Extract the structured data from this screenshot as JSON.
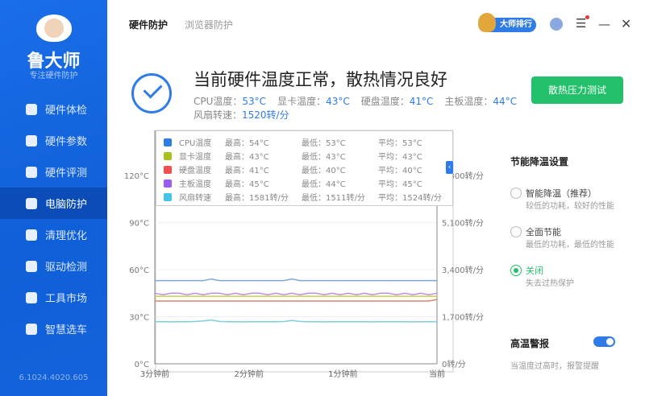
{
  "sidebar": {
    "logo_title": "鲁大师",
    "logo_subtitle": "专注硬件防护",
    "version": "6.1024.4020.605",
    "items": [
      {
        "label": "硬件体检",
        "icon": "monitor-icon"
      },
      {
        "label": "硬件参数",
        "icon": "list-icon"
      },
      {
        "label": "硬件评测",
        "icon": "gauge-icon"
      },
      {
        "label": "电脑防护",
        "icon": "shield-icon"
      },
      {
        "label": "清理优化",
        "icon": "broom-icon"
      },
      {
        "label": "驱动检测",
        "icon": "gear-icon"
      },
      {
        "label": "工具市场",
        "icon": "toolbox-icon"
      },
      {
        "label": "智慧选车",
        "icon": "car-icon"
      }
    ],
    "active": 3
  },
  "header": {
    "tabs": [
      "硬件防护",
      "浏览器防护"
    ],
    "rank_label": "大师排行"
  },
  "status": {
    "headline": "当前硬件温度正常，散热情况良好",
    "stats": [
      {
        "label": "CPU温度：",
        "value": "53°C"
      },
      {
        "label": "显卡温度：",
        "value": "43°C"
      },
      {
        "label": "硬盘温度：",
        "value": "41°C"
      },
      {
        "label": "主板温度：",
        "value": "44°C"
      },
      {
        "label": "风扇转速：",
        "value": "1520转/分"
      }
    ],
    "stress_button": "散热压力测试"
  },
  "legend": [
    {
      "name": "CPU温度",
      "max": "最高：54°C",
      "min": "最低：53°C",
      "avg": "平均：53°C",
      "color": "#2f7be8"
    },
    {
      "name": "显卡温度",
      "max": "最高：43°C",
      "min": "最低：43°C",
      "avg": "平均：43°C",
      "color": "#a8c41a"
    },
    {
      "name": "硬盘温度",
      "max": "最高：41°C",
      "min": "最低：40°C",
      "avg": "平均：40°C",
      "color": "#f05050"
    },
    {
      "name": "主板温度",
      "max": "最高：45°C",
      "min": "最低：44°C",
      "avg": "平均：45°C",
      "color": "#9a5cf0"
    },
    {
      "name": "风扇转速",
      "max": "最高：1581转/分",
      "min": "最低：1511转/分",
      "avg": "平均：1524转/分",
      "color": "#40c4e8"
    }
  ],
  "chart_data": {
    "type": "line",
    "x_labels": [
      "3分钟前",
      "2分钟前",
      "1分钟前",
      "当前"
    ],
    "y_left": {
      "ticks": [
        "0°C",
        "30°C",
        "60°C",
        "90°C",
        "120°C"
      ],
      "range": [
        0,
        120
      ]
    },
    "y_right": {
      "ticks": [
        "0转/分",
        "1,700转/分",
        "3,400转/分",
        "5,100转/分",
        "6,800转/分"
      ],
      "range": [
        0,
        6800
      ]
    },
    "series": [
      {
        "name": "CPU温度",
        "axis": "left",
        "color": "#7fa8d8",
        "values": [
          53,
          53,
          53,
          53,
          53,
          53,
          53,
          54,
          53,
          53,
          53,
          53,
          53,
          53,
          53,
          53,
          53,
          54,
          53,
          53,
          53,
          53,
          53,
          53,
          53,
          53,
          53,
          53,
          53,
          53,
          53,
          53,
          53,
          53,
          53,
          53
        ]
      },
      {
        "name": "主板温度",
        "axis": "left",
        "color": "#c08ce8",
        "values": [
          45,
          44,
          45,
          45,
          44,
          45,
          44,
          45,
          45,
          44,
          45,
          44,
          45,
          45,
          44,
          45,
          44,
          45,
          44,
          45,
          45,
          44,
          45,
          44,
          45,
          44,
          45,
          44,
          45,
          45,
          44,
          45,
          44,
          45,
          44,
          45
        ]
      },
      {
        "name": "显卡温度",
        "axis": "left",
        "color": "#c8d040",
        "values": [
          43,
          43,
          43,
          43,
          43,
          43,
          43,
          43,
          43,
          43,
          43,
          43,
          43,
          43,
          43,
          43,
          43,
          43,
          43,
          43,
          43,
          43,
          43,
          43,
          43,
          43,
          43,
          43,
          43,
          43,
          43,
          43,
          43,
          43,
          43,
          43
        ]
      },
      {
        "name": "硬盘温度",
        "axis": "left",
        "color": "#e08070",
        "values": [
          40,
          40,
          40,
          40,
          40,
          40,
          40,
          40,
          40,
          40,
          40,
          40,
          40,
          40,
          40,
          40,
          40,
          40,
          40,
          40,
          40,
          40,
          40,
          40,
          40,
          40,
          40,
          40,
          40,
          40,
          40,
          40,
          40,
          40,
          40,
          41
        ]
      },
      {
        "name": "风扇转速",
        "axis": "right",
        "color": "#80cce0",
        "values": [
          1520,
          1520,
          1515,
          1520,
          1520,
          1525,
          1545,
          1581,
          1530,
          1520,
          1520,
          1515,
          1520,
          1520,
          1520,
          1520,
          1525,
          1565,
          1530,
          1520,
          1520,
          1515,
          1520,
          1520,
          1520,
          1520,
          1520,
          1515,
          1520,
          1520,
          1520,
          1520,
          1515,
          1520,
          1520,
          1520
        ]
      }
    ]
  },
  "settings": {
    "title": "节能降温设置",
    "options": [
      {
        "label": "智能降温（推荐）",
        "desc": "较低的功耗，较好的性能",
        "selected": false
      },
      {
        "label": "全面节能",
        "desc": "最低的功耗，最低的性能",
        "selected": false
      },
      {
        "label": "关闭",
        "desc": "失去过热保护",
        "selected": true
      }
    ],
    "alarm_title": "高温警报",
    "alarm_desc": "当温度过高时，报警提醒",
    "alarm_on": true
  }
}
